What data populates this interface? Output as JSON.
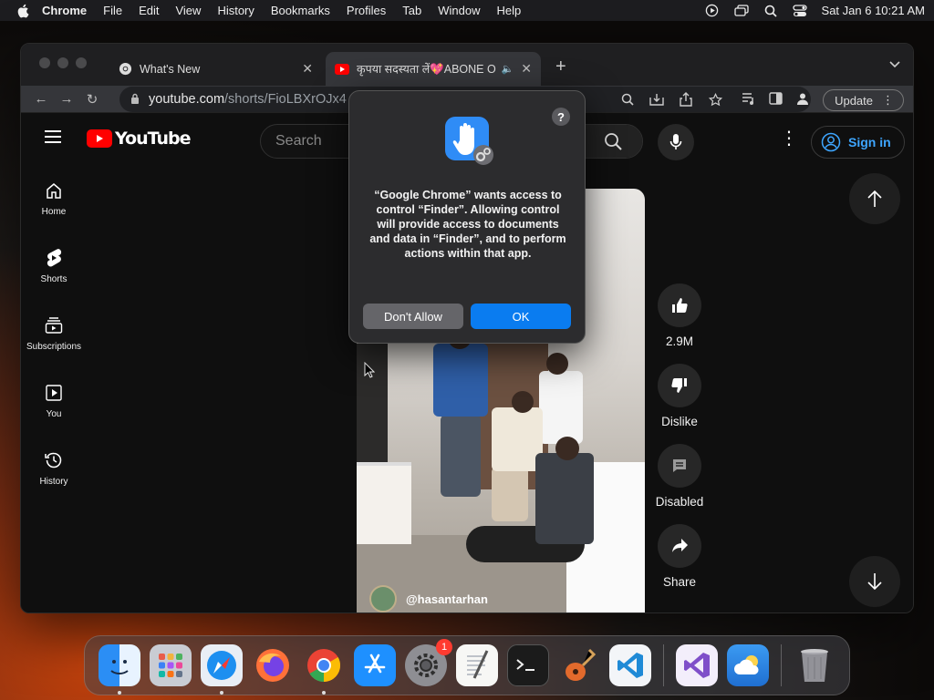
{
  "menubar": {
    "app_name": "Chrome",
    "items": [
      "File",
      "Edit",
      "View",
      "History",
      "Bookmarks",
      "Profiles",
      "Tab",
      "Window",
      "Help"
    ],
    "datetime": "Sat Jan 6  10:21 AM"
  },
  "browser": {
    "tabs": [
      {
        "title": "What's New",
        "active": false
      },
      {
        "title": "कृपया सदस्यता लें💖ABONE OL",
        "active": true,
        "audio": true
      }
    ],
    "url_host": "youtube.com",
    "url_path": "/shorts/FioLBXrOJx4",
    "update_label": "Update"
  },
  "youtube": {
    "logo_text": "YouTube",
    "search_placeholder": "Search",
    "sign_in_label": "Sign in",
    "sidebar": [
      {
        "label": "Home",
        "icon": "home-icon"
      },
      {
        "label": "Shorts",
        "icon": "shorts-icon"
      },
      {
        "label": "Subscriptions",
        "icon": "subscriptions-icon"
      },
      {
        "label": "You",
        "icon": "you-icon"
      },
      {
        "label": "History",
        "icon": "history-icon"
      }
    ],
    "short": {
      "channel": "@hasantarhan",
      "likes": "2.9M",
      "dislike_label": "Dislike",
      "comments_label": "Disabled",
      "share_label": "Share"
    }
  },
  "dialog": {
    "message": "“Google Chrome” wants access to control “Finder”. Allowing control will provide access to documents and data in “Finder”, and to perform actions within that app.",
    "help_label": "?",
    "deny_label": "Don't Allow",
    "ok_label": "OK"
  },
  "dock": {
    "apps": [
      "Finder",
      "Launchpad",
      "Safari",
      "Firefox",
      "Chrome",
      "App Store",
      "System Settings",
      "TextEdit",
      "Terminal",
      "GarageBand",
      "Visual Studio Code",
      "Visual Studio",
      "Weather",
      "Trash"
    ],
    "settings_badge": "1"
  },
  "colors": {
    "accent": "#0a7cf0",
    "youtube_red": "#ff0000",
    "signin_blue": "#3ea6ff"
  }
}
